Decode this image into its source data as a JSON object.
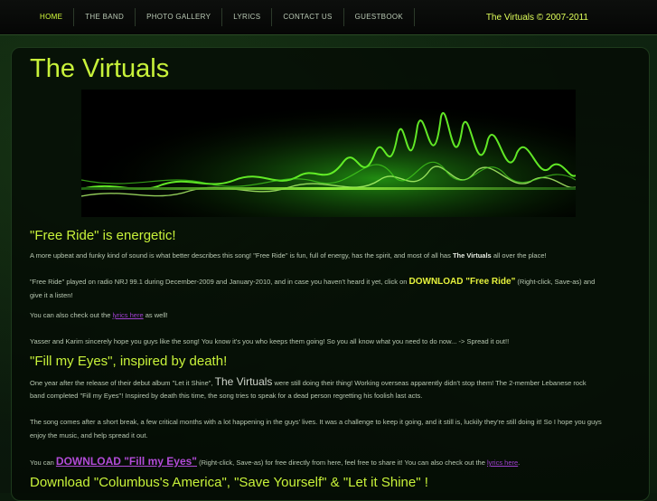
{
  "nav": {
    "items": [
      "HOME",
      "THE BAND",
      "PHOTO GALLERY",
      "LYRICS",
      "CONTACT US",
      "GUESTBOOK"
    ],
    "copyright": "The Virtuals © 2007-2011"
  },
  "site_title": "The Virtuals",
  "sections": {
    "free_ride": {
      "heading": "\"Free Ride\" is energetic!",
      "p1_a": "A more upbeat and funky kind of sound is what better describes this song! \"Free Ride\" is fun, full of energy, has the spirit, and most of all has ",
      "p1_b": "The Virtuals",
      "p1_c": " all over the place!",
      "p2_a": "\"Free Ride\" played on radio NRJ 99.1 during December-2009 and January-2010, and in case you haven't heard it yet, click on ",
      "p2_download": "DOWNLOAD \"Free Ride\"",
      "p2_b": " (Right-click, Save-as) and",
      "p2_c": "give it a listen!",
      "p3_a": "You can also check out the ",
      "p3_link": "lyrics here",
      "p3_b": " as well!",
      "p4": "Yasser and Karim sincerely hope you guys like the song! You know it's you who keeps them going! So you all know what you need to do now... -> Spread it out!!"
    },
    "fill_my_eyes": {
      "heading": "\"Fill my Eyes\", inspired by death!",
      "p1_a": "One year after the release of their debut album \"Let it Shine\", ",
      "p1_name": "The Virtuals",
      "p1_b": " were still doing their thing! Working overseas apparently didn't stop them! The 2-member Lebanese rock",
      "p1_c": "band completed \"Fill my Eyes\"! Inspired by death this time, the song tries to speak for a dead person regretting his foolish last acts.",
      "p2_a": "The song comes after a short break, a few critical months with a lot happening in the guys' lives. It was a challenge to keep it going, and it still is, luckily they're still doing it! So I hope you guys",
      "p2_b": "enjoy the music, and help spread it out.",
      "p3_a": "You can ",
      "p3_download": "DOWNLOAD \"Fill my Eyes\"",
      "p3_b": " (Right-click, Save-as) for free directly from here, feel free to share it! You can also check out the ",
      "p3_link": "lyrics here",
      "p3_c": "."
    },
    "download_heading": "Download \"Columbus's America\", \"Save Yourself\" & \"Let it Shine\" !"
  }
}
